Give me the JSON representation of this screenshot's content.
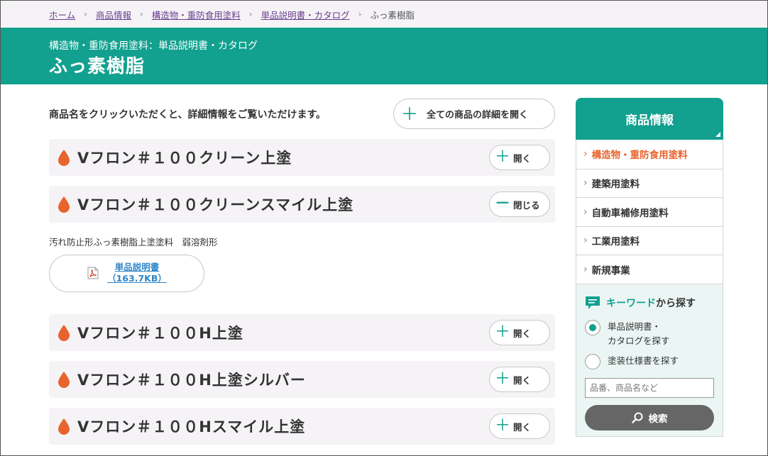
{
  "breadcrumb": {
    "items": [
      "ホーム",
      "商品情報",
      "構造物・重防食用塗料",
      "単品説明書・カタログ"
    ],
    "current": "ふっ素樹脂"
  },
  "header": {
    "subtitle": "構造物・重防食用塗料：単品説明書・カタログ",
    "title": "ふっ素樹脂"
  },
  "main": {
    "intro": "商品名をクリックいただくと、詳細情報をご覧いただけます。",
    "open_all_label": "全ての商品の詳細を開く",
    "products": [
      {
        "name": "Vフロン＃１００クリーン上塗",
        "toggle": "開く"
      },
      {
        "name": "Vフロン＃１００クリーンスマイル上塗",
        "toggle": "閉じる"
      },
      {
        "name": "Vフロン＃１００H上塗",
        "toggle": "開く"
      },
      {
        "name": "Vフロン＃１００H上塗シルバー",
        "toggle": "開く"
      },
      {
        "name": "Vフロン＃１００Hスマイル上塗",
        "toggle": "開く"
      }
    ],
    "expanded": {
      "description": "汚れ防止形ふっ素樹脂上塗塗料　弱溶剤形",
      "pdf_title": "単品説明書",
      "pdf_size": "（163.7KB）"
    }
  },
  "sidebar": {
    "title": "商品情報",
    "items": [
      {
        "label": "構造物・重防食用塗料",
        "active": true
      },
      {
        "label": "建築用塗料",
        "active": false
      },
      {
        "label": "自動車補修用塗料",
        "active": false
      },
      {
        "label": "工業用塗料",
        "active": false
      },
      {
        "label": "新規事業",
        "active": false
      }
    ],
    "keyword": {
      "title_accent": "キーワード",
      "title_rest": "から探す",
      "options": [
        "単品説明書・カタログを探す",
        "塗装仕様書を探す"
      ],
      "option1_line1": "単品説明書・",
      "option1_line2": "カタログを探す",
      "option2": "塗装仕様書を探す",
      "placeholder": "品番、商品名など",
      "search_label": "検索"
    }
  },
  "colors": {
    "brand": "#12a08f",
    "accent": "#e8642e",
    "link": "#2f86c9",
    "breadcrumb_link": "#6a3f8f"
  }
}
